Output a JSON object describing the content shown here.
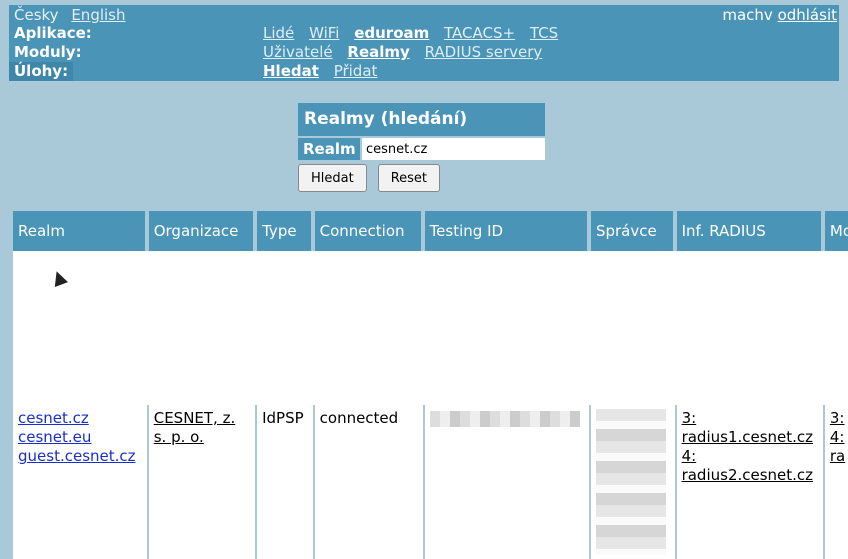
{
  "nav": {
    "lang_current": "Česky",
    "lang_other": "English",
    "user": "machv",
    "logout": "odhlásit",
    "rows": [
      {
        "label": "Aplikace:",
        "items": [
          "Lidé",
          "WiFi",
          "eduroam",
          "TACACS+",
          "TCS"
        ],
        "active": "eduroam"
      },
      {
        "label": "Moduly:",
        "items": [
          "Uživatelé",
          "Realmy",
          "RADIUS servery"
        ],
        "active": "Realmy"
      },
      {
        "label": "Úlohy:",
        "items": [
          "Hledat",
          "Přidat"
        ],
        "active": "Hledat"
      }
    ]
  },
  "search": {
    "title": "Realmy (hledání)",
    "label": "Realm",
    "value": "cesnet.cz",
    "search_button": "Hledat",
    "reset_button": "Reset"
  },
  "table": {
    "headers": [
      "Realm",
      "Organizace",
      "Type",
      "Connection",
      "Testing ID",
      "Správce",
      "Inf. RADIUS",
      "Mo"
    ],
    "row": {
      "realms": [
        "cesnet.cz",
        "cesnet.eu",
        "guest.cesnet.cz"
      ],
      "organizace": "CESNET, z. s. p. o.",
      "type": "IdPSP",
      "connection": "connected",
      "radius": [
        "3:",
        "radius1.cesnet.cz",
        "4:",
        "radius2.cesnet.cz"
      ],
      "mo": [
        "3:",
        "4:",
        "ra"
      ]
    }
  }
}
